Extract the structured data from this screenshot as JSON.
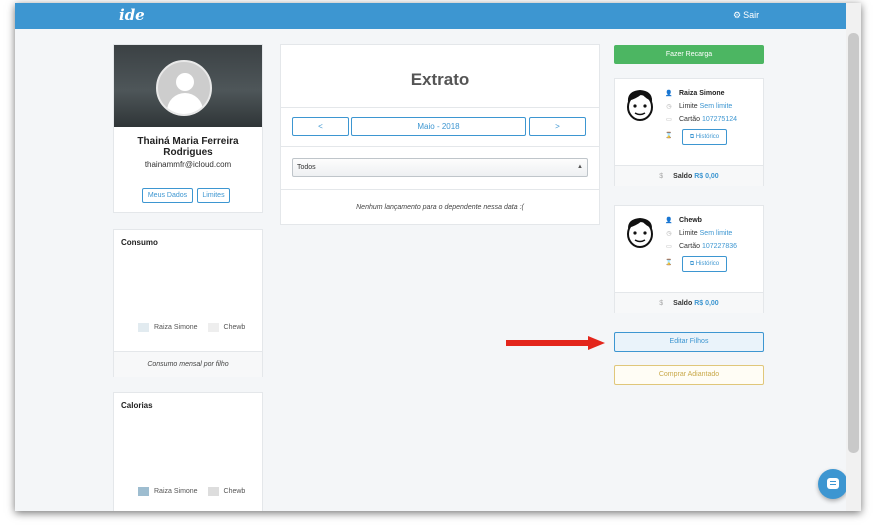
{
  "header": {
    "logo": "ide",
    "logout_label": "Sair",
    "logout_icon": "gear-icon"
  },
  "profile": {
    "name": "Thainá Maria Ferreira Rodrigues",
    "email": "thainammfr@icloud.com",
    "btn_dados": "Meus Dados",
    "btn_limites": "Limites"
  },
  "consumo": {
    "title": "Consumo",
    "legend": [
      "Raiza Simone",
      "Chewb"
    ],
    "footer": "Consumo mensal por filho"
  },
  "calorias": {
    "title": "Calorias",
    "legend": [
      "Raiza Simone",
      "Chewb"
    ]
  },
  "extrato": {
    "title": "Extrato",
    "prev": "<",
    "month": "Maio - 2018",
    "next": ">",
    "filter": "Todos",
    "empty": "Nenhum lançamento para o dependente nessa data :("
  },
  "recarga_label": "Fazer Recarga",
  "children": [
    {
      "name": "Raiza Simone",
      "limite_label": "Limite",
      "limite": "Sem limite",
      "cartao_label": "Cartão",
      "cartao": "107275124",
      "historico": "Histórico",
      "saldo_label": "Saldo",
      "saldo": "R$ 0,00"
    },
    {
      "name": "Chewb",
      "limite_label": "Limite",
      "limite": "Sem limite",
      "cartao_label": "Cartão",
      "cartao": "107227836",
      "historico": "Histórico",
      "saldo_label": "Saldo",
      "saldo": "R$ 0,00"
    }
  ],
  "editar_filhos": "Editar Filhos",
  "comprar_adiantado": "Comprar Adiantado",
  "colors": {
    "primary": "#3d96d1",
    "success": "#4cb662",
    "arrow": "#e3261c",
    "warning": "#e0c77a"
  }
}
